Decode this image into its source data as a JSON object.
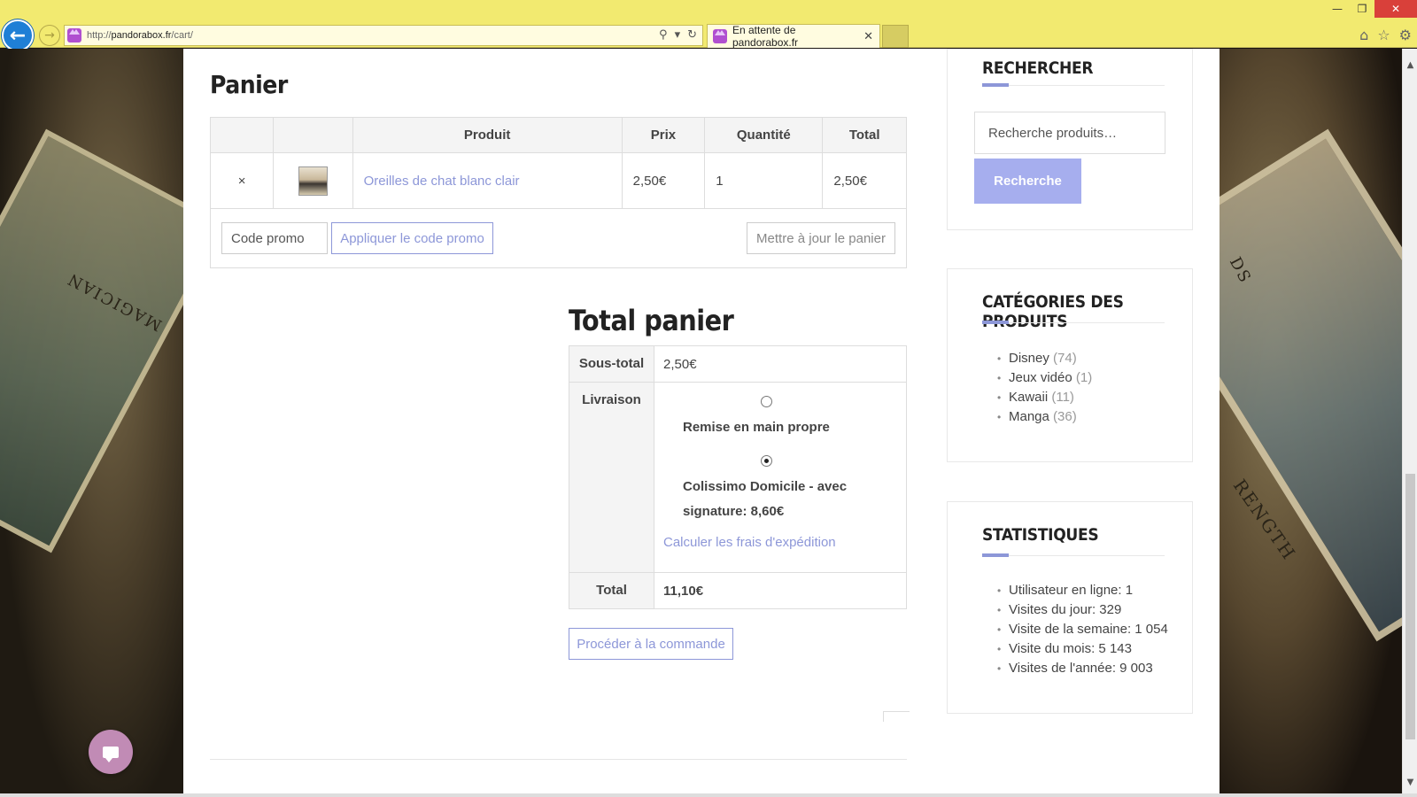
{
  "browser": {
    "url_prefix": "http://",
    "url_host": "pandorabox.fr",
    "url_path": "/cart/",
    "tab_title": "En attente de pandorabox.fr",
    "icons": [
      "back-arrow-icon",
      "forward-arrow-icon",
      "search-icon",
      "dropdown-icon",
      "refresh-icon",
      "close-icon",
      "home-icon",
      "star-icon",
      "gear-icon"
    ]
  },
  "background": {
    "left_card_text": "MAGICIAN",
    "right_card_text_1": "DS",
    "right_card_text_2": "RENGTH"
  },
  "cart": {
    "title": "Panier",
    "headers": [
      "",
      "",
      "Produit",
      "Prix",
      "Quantité",
      "Total"
    ],
    "items": [
      {
        "remove": "×",
        "name": "Oreilles de chat blanc clair",
        "price": "2,50€",
        "quantity": "1",
        "total": "2,50€"
      }
    ],
    "coupon_placeholder": "Code promo",
    "apply_label": "Appliquer le code promo",
    "update_label": "Mettre à jour le panier"
  },
  "totals": {
    "title": "Total panier",
    "subtotal_label": "Sous-total",
    "subtotal_value": "2,50€",
    "shipping_label": "Livraison",
    "shipping_options": [
      {
        "label": "Remise en main propre",
        "selected": false
      },
      {
        "label": "Colissimo Domicile - avec signature: 8,60€",
        "selected": true
      }
    ],
    "calc_link": "Calculer les frais d'expédition",
    "total_label": "Total",
    "total_value": "11,10€",
    "checkout_label": "Procéder à la commande"
  },
  "sidebar": {
    "search": {
      "title": "RECHERCHER",
      "placeholder": "Recherche produits…",
      "button": "Recherche"
    },
    "categories": {
      "title": "CATÉGORIES DES PRODUITS",
      "items": [
        {
          "name": "Disney",
          "count": "(74)"
        },
        {
          "name": "Jeux vidéo",
          "count": "(1)"
        },
        {
          "name": "Kawaii",
          "count": "(11)"
        },
        {
          "name": "Manga",
          "count": "(36)"
        }
      ]
    },
    "stats": {
      "title": "STATISTIQUES",
      "items": [
        "Utilisateur en ligne: 1",
        "Visites du jour: 329",
        "Visite de la semaine: 1 054",
        "Visite du mois: 5 143",
        "Visites de l'année: 9 003"
      ]
    }
  },
  "colors": {
    "accent": "#8d97d8",
    "button_fill": "#a6aeee",
    "chrome": "#f2ea70",
    "remove": "#e05050",
    "chat": "#c18bb5"
  }
}
